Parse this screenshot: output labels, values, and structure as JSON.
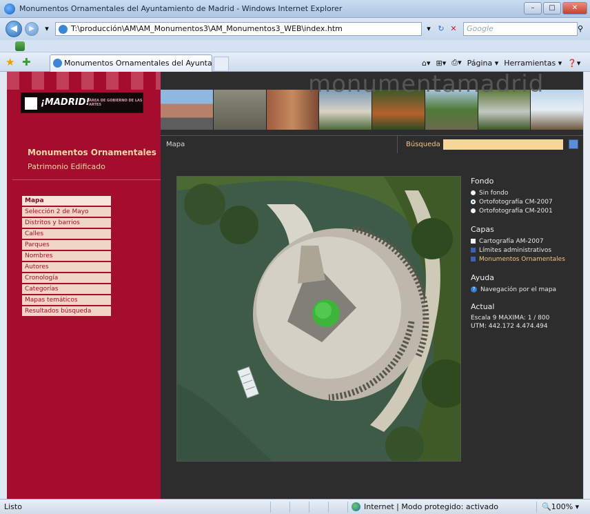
{
  "window": {
    "title": "Monumentos Ornamentales del Ayuntamiento de Madrid - Windows Internet Explorer",
    "buttons": {
      "minimize": "–",
      "maximize": "□",
      "close": "✕"
    }
  },
  "address_bar": {
    "url": "T:\\producción\\AM\\AM_Monumentos3\\AM_Monumentos3_WEB\\index.htm",
    "search_placeholder": "Google"
  },
  "tab": {
    "label": "Monumentos Ornamentales del Ayuntamiento d..."
  },
  "command_bar": {
    "page_label": "Página",
    "tools_label": "Herramientas"
  },
  "site": {
    "logo_text": "¡MADRID!",
    "logo_subtext": "ÁREA DE GOBIERNO DE LAS ARTES",
    "brand": "monumentamadrid",
    "section_title": "Monumentos Ornamentales",
    "section_subtitle": "Patrimonio Edificado",
    "menu": [
      {
        "label": "Mapa",
        "active": true
      },
      {
        "label": "Selección 2 de Mayo",
        "active": false
      },
      {
        "label": "Distritos y barrios",
        "active": false
      },
      {
        "label": "Calles",
        "active": false
      },
      {
        "label": "Parques",
        "active": false
      },
      {
        "label": "Nombres",
        "active": false
      },
      {
        "label": "Autores",
        "active": false
      },
      {
        "label": "Cronología",
        "active": false
      },
      {
        "label": "Categorías",
        "active": false
      },
      {
        "label": "Mapas temáticos",
        "active": false
      },
      {
        "label": "Resultados búsqueda",
        "active": false
      }
    ],
    "page_tab": "Mapa",
    "search_label": "Búsqueda"
  },
  "panel": {
    "fondo_title": "Fondo",
    "fondo_options": [
      {
        "label": "Sin fondo",
        "selected": false
      },
      {
        "label": "Ortofotografía CM-2007",
        "selected": true
      },
      {
        "label": "Ortofotografía CM-2001",
        "selected": false
      }
    ],
    "capas_title": "Capas",
    "capas_options": [
      {
        "label": "Cartografía AM-2007",
        "checked": false,
        "highlight": false
      },
      {
        "label": "Límites administrativos",
        "checked": true,
        "highlight": false
      },
      {
        "label": "Monumentos Ornamentales",
        "checked": true,
        "highlight": true
      }
    ],
    "ayuda_title": "Ayuda",
    "ayuda_link": "Navegación por el mapa",
    "actual_title": "Actual",
    "escala": "Escala 9 MAXIMA: 1 / 800",
    "utm": "UTM: 442.172 4.474.494"
  },
  "status_bar": {
    "left": "Listo",
    "zone": "Internet | Modo protegido: activado",
    "zoom": "100%"
  }
}
